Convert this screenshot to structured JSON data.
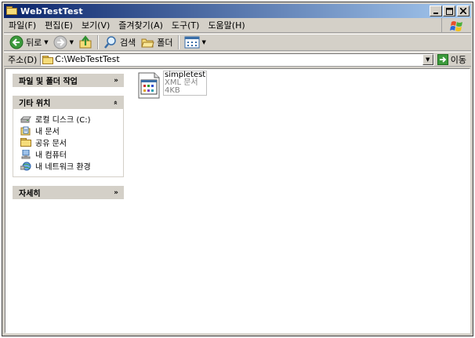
{
  "window": {
    "title": "WebTestTest"
  },
  "menu": [
    "파일(F)",
    "편집(E)",
    "보기(V)",
    "즐겨찾기(A)",
    "도구(T)",
    "도움말(H)"
  ],
  "toolbar": {
    "back_label": "뒤로",
    "search_label": "검색",
    "folders_label": "폴더"
  },
  "address": {
    "label": "주소(D)",
    "value": "C:\\WebTestTest",
    "go_label": "이동"
  },
  "panels": {
    "tasks": {
      "title": "파일 및 폴더 작업"
    },
    "places": {
      "title": "기타 위치",
      "items": [
        "로컬 디스크 (C:)",
        "내 문서",
        "공유 문서",
        "내 컴퓨터",
        "내 네트워크 환경"
      ]
    },
    "details": {
      "title": "자세히"
    }
  },
  "file": {
    "name": "simpletest",
    "type": "XML 문서",
    "size": "4KB"
  },
  "colors": {
    "titlebar_start": "#0a246a",
    "titlebar_end": "#a6caf0",
    "chrome": "#d4d0c8"
  }
}
